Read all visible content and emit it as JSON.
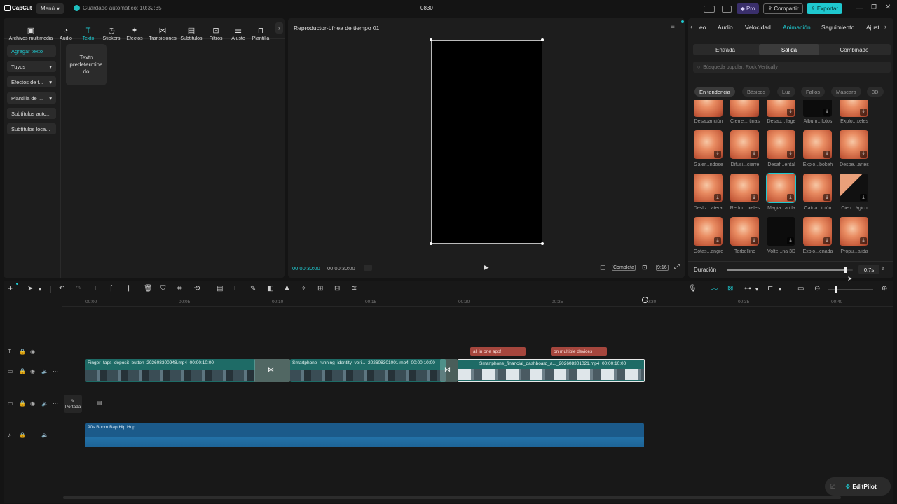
{
  "titlebar": {
    "logo": "CapCut",
    "menu": "Menú",
    "autosave": "Guardado automático: 10:32:35",
    "title": "0830",
    "pro": "Pro",
    "share": "Compartir",
    "export": "Exportar"
  },
  "left_toolbar": [
    {
      "label": "Archivos multimedia",
      "icon": "media-icon"
    },
    {
      "label": "Audio",
      "icon": "audio-icon"
    },
    {
      "label": "Texto",
      "icon": "text-icon"
    },
    {
      "label": "Stickers",
      "icon": "stickers-icon"
    },
    {
      "label": "Efectos",
      "icon": "effects-icon"
    },
    {
      "label": "Transiciones",
      "icon": "transitions-icon"
    },
    {
      "label": "Subtítulos",
      "icon": "subtitles-icon"
    },
    {
      "label": "Filtros",
      "icon": "filters-icon"
    },
    {
      "label": "Ajuste",
      "icon": "adjust-icon"
    },
    {
      "label": "Plantilla",
      "icon": "template-icon"
    }
  ],
  "left_toolbar_active": "Texto",
  "left_sidebar": [
    "Agregar texto",
    "Tuyos",
    "Efectos de t...",
    "Plantilla de ...",
    "Subtítulos auto...",
    "Subtítulos loca..."
  ],
  "default_text_card": "Texto predetermina do",
  "player": {
    "title": "Reproductor-Línea de tiempo 01",
    "current_time": "00:00:30:00",
    "total_time": "00:00:30:00",
    "quality": "Completa",
    "ratio": "9:16"
  },
  "right_panel": {
    "tabs": [
      "eo",
      "Audio",
      "Velocidad",
      "Animación",
      "Seguimiento",
      "Ajust"
    ],
    "active_tab": "Animación",
    "segments": [
      "Entrada",
      "Salida",
      "Combinado"
    ],
    "active_segment": "Salida",
    "search_placeholder": "Búsqueda popular: Rock Vertically",
    "chips": [
      "En tendencia",
      "Básicos",
      "Luz",
      "Fallos",
      "Máscara",
      "3D"
    ],
    "active_chip": "En tendencia",
    "animations": [
      [
        "Desaparición",
        "Cierre...rtinas",
        "Desap...llage",
        "Álbum...fotos",
        "Explo...xeles"
      ],
      [
        "Galer...ndose",
        "Difusi...cierre",
        "Desaf...ental",
        "Explo...bokeh",
        "Despe...artes"
      ],
      [
        "Desliz...ateral",
        "Reduc...xeles",
        "Magia...alida",
        "Caída...ición",
        "Cierr...ágico"
      ],
      [
        "Gotas...angre",
        "Torbellino",
        "Volte...na 3D",
        "Explo...enada",
        "Propu...alida"
      ]
    ],
    "duration_label": "Duración",
    "duration_value": "0.7s",
    "duration_fraction": 0.94
  },
  "timeline": {
    "ruler": [
      "00:00",
      "00:05",
      "00:10",
      "00:15",
      "00:20",
      "00:25",
      "00:30",
      "00:35",
      "00:40"
    ],
    "cover_label": "Portada",
    "text_clips": [
      "all in one app!!",
      "on multiple devices"
    ],
    "video_clips": [
      {
        "name": "Finger_taps_deposit_button_202608300948.mp4",
        "duration": "00:00:10:00"
      },
      {
        "name": "Smartphone_running_identity_veri..._202608301001.mp4",
        "duration": "00:00:10:00"
      },
      {
        "name": "Smartphone_financial_dashboard_a..._202608301021.mp4",
        "duration": "00:00:10:00"
      }
    ],
    "audio_clip": "90s Boom Bap Hip Hop"
  },
  "editpilot": "EditPilot",
  "colors": {
    "accent": "#1fc8cf",
    "video_clip": "#1e6b66",
    "text_clip": "#a5463d",
    "audio_clip": "#1b5a8a"
  }
}
